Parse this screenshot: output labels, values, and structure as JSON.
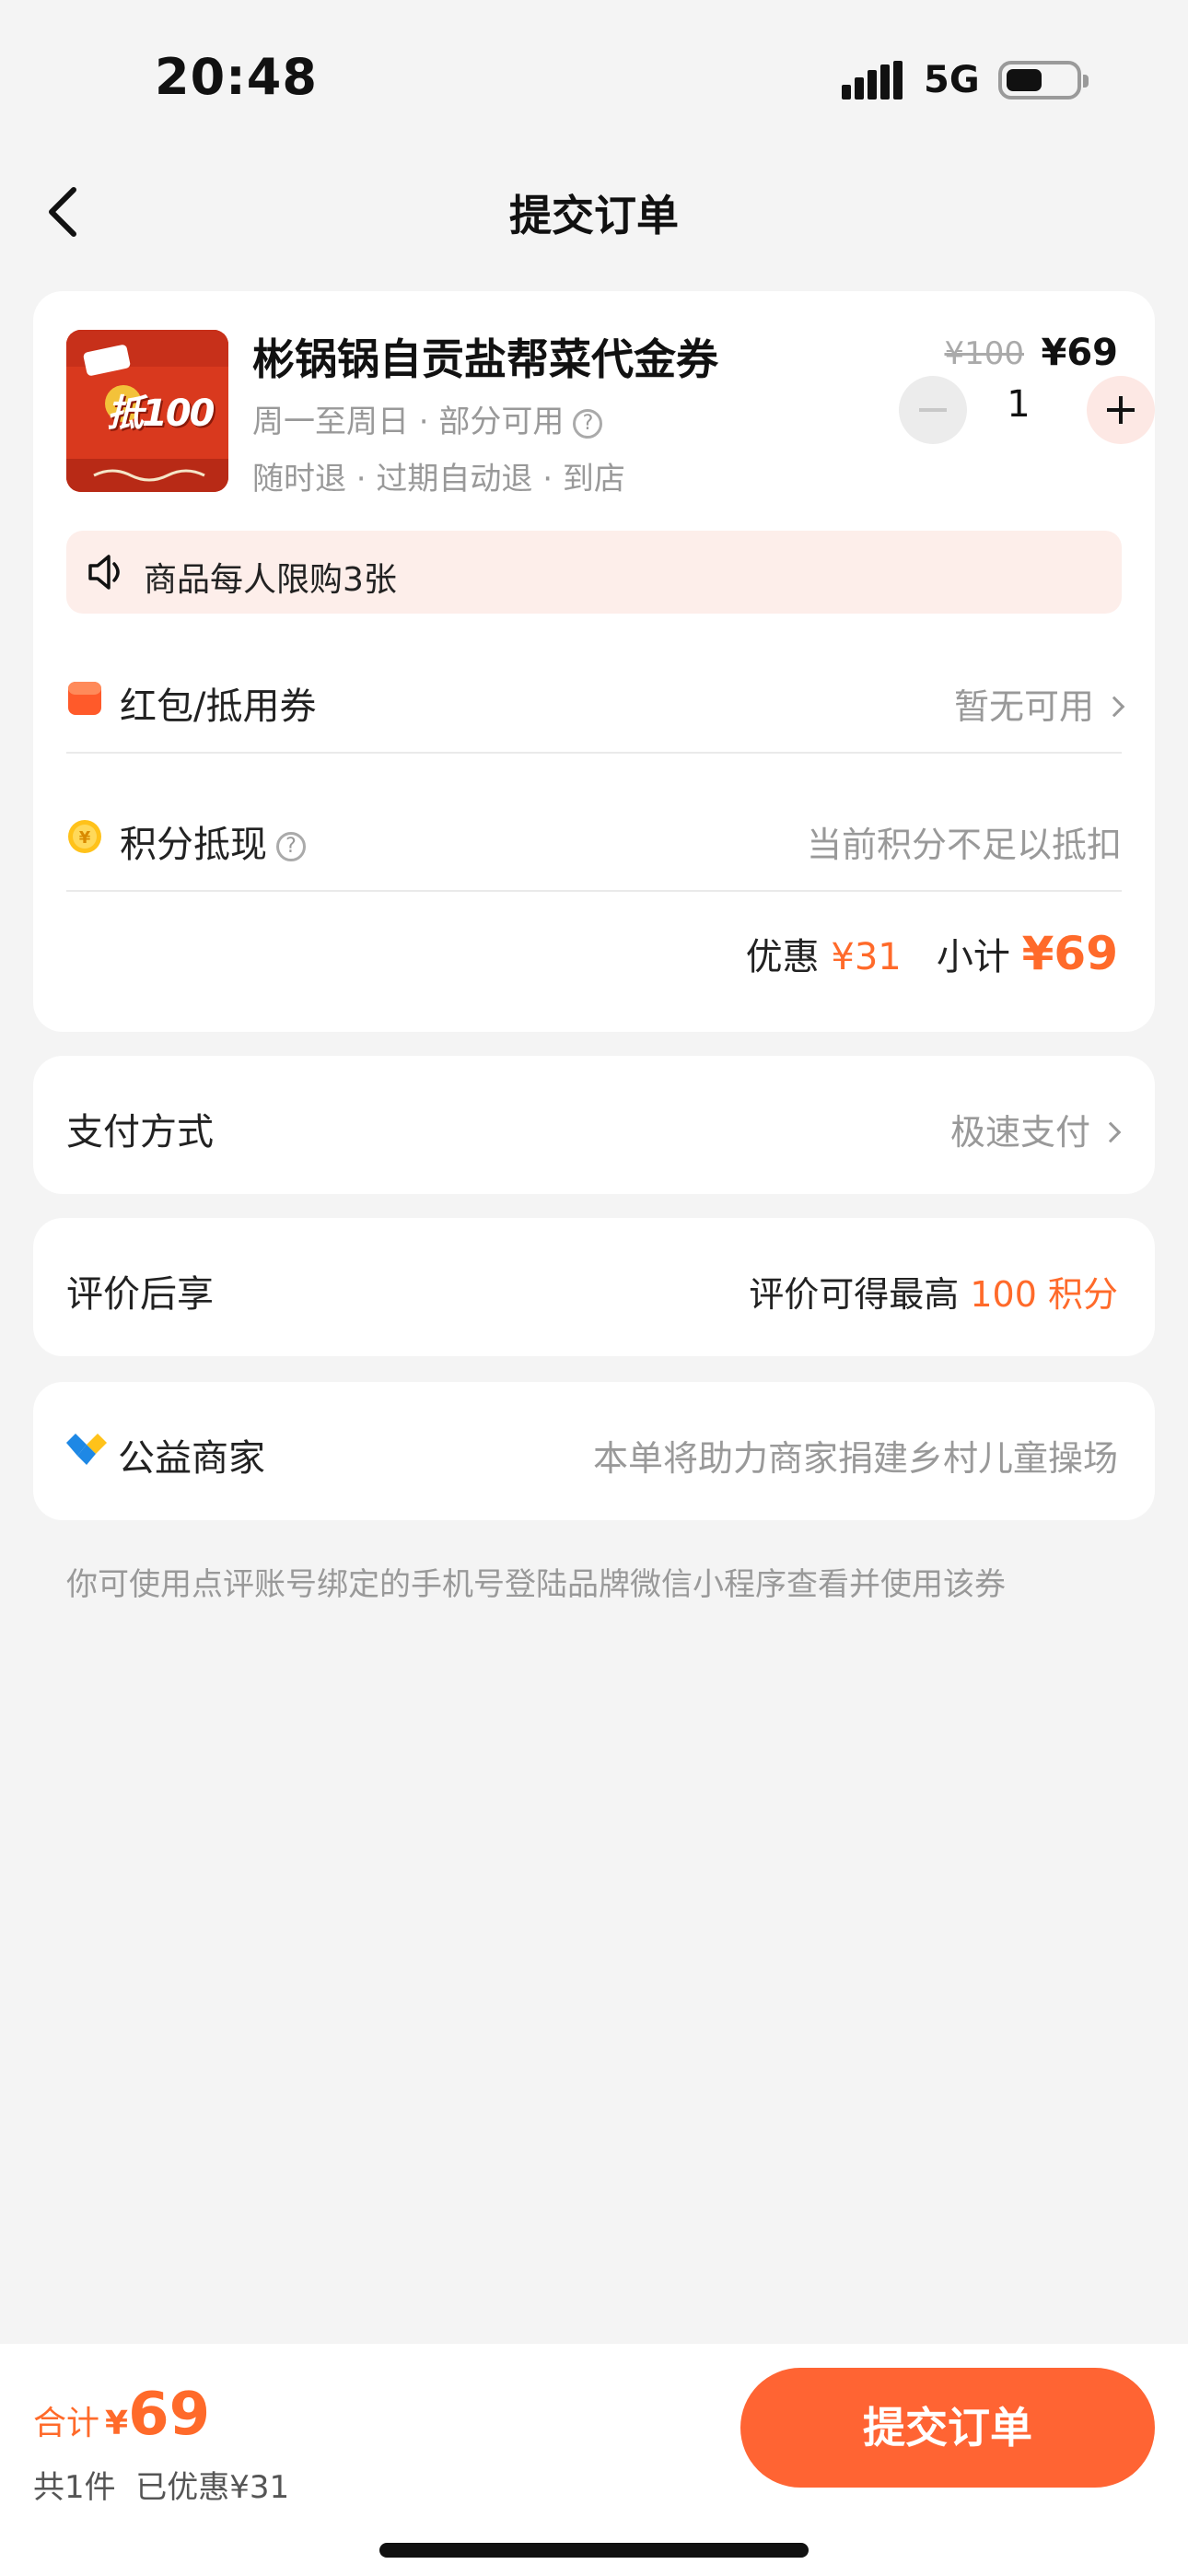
{
  "status_bar": {
    "time": "20:48",
    "network": "5G"
  },
  "nav": {
    "title": "提交订单"
  },
  "product": {
    "thumb_text": "抵100",
    "title": "彬锅锅自贡盐帮菜代金券",
    "sub1": "周一至周日 · 部分可用",
    "sub2": "随时退 · 过期自动退 · 到店",
    "original_price": "¥100",
    "price": "¥69",
    "quantity": "1"
  },
  "limit": {
    "text": "商品每人限购3张"
  },
  "coupon": {
    "label": "红包/抵用券",
    "value": "暂无可用"
  },
  "points": {
    "label": "积分抵现",
    "value": "当前积分不足以抵扣"
  },
  "summary": {
    "discount_label": "优惠",
    "discount": "¥31",
    "subtotal_label": "小计",
    "subtotal": "¥69"
  },
  "payment": {
    "label": "支付方式",
    "value": "极速支付"
  },
  "review": {
    "label": "评价后享",
    "value_prefix": "评价可得最高",
    "value_highlight": "100 积分"
  },
  "charity": {
    "label": "公益商家",
    "value": "本单将助力商家捐建乡村儿童操场"
  },
  "footnote": "你可使用点评账号绑定的手机号登陆品牌微信小程序查看并使用该券",
  "bottom": {
    "total_label": "合计",
    "currency": "¥",
    "total_amount": "69",
    "count": "共1件",
    "saved": "已优惠¥31",
    "submit_label": "提交订单"
  },
  "colors": {
    "accent": "#ff6a2a",
    "button": "#ff6433",
    "background": "#f4f4f4"
  }
}
